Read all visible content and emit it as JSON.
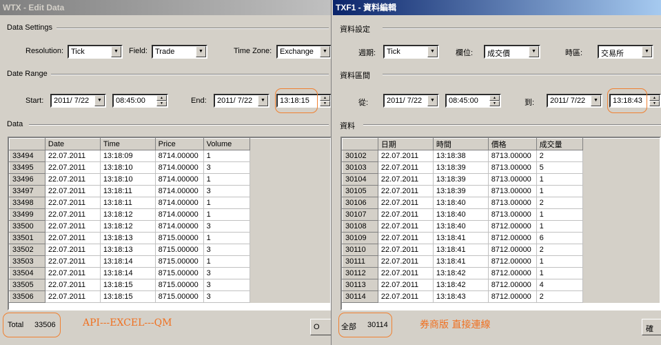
{
  "left": {
    "title": "WTX - Edit Data",
    "settings_label": "Data Settings",
    "resolution_label": "Resolution:",
    "resolution_value": "Tick",
    "field_label": "Field:",
    "field_value": "Trade",
    "timezone_label": "Time Zone:",
    "timezone_value": "Exchange",
    "range_label": "Date Range",
    "start_label": "Start:",
    "start_date": "2011/ 7/22",
    "start_time": "08:45:00",
    "end_label": "End:",
    "end_date": "2011/ 7/22",
    "end_time": "13:18:15",
    "data_label": "Data",
    "columns": [
      "Date",
      "Time",
      "Price",
      "Volume"
    ],
    "rows": [
      [
        "33494",
        "22.07.2011",
        "13:18:09",
        "8714.00000",
        "1"
      ],
      [
        "33495",
        "22.07.2011",
        "13:18:10",
        "8714.00000",
        "3"
      ],
      [
        "33496",
        "22.07.2011",
        "13:18:10",
        "8714.00000",
        "1"
      ],
      [
        "33497",
        "22.07.2011",
        "13:18:11",
        "8714.00000",
        "3"
      ],
      [
        "33498",
        "22.07.2011",
        "13:18:11",
        "8714.00000",
        "1"
      ],
      [
        "33499",
        "22.07.2011",
        "13:18:12",
        "8714.00000",
        "1"
      ],
      [
        "33500",
        "22.07.2011",
        "13:18:12",
        "8714.00000",
        "3"
      ],
      [
        "33501",
        "22.07.2011",
        "13:18:13",
        "8715.00000",
        "1"
      ],
      [
        "33502",
        "22.07.2011",
        "13:18:13",
        "8715.00000",
        "3"
      ],
      [
        "33503",
        "22.07.2011",
        "13:18:14",
        "8715.00000",
        "1"
      ],
      [
        "33504",
        "22.07.2011",
        "13:18:14",
        "8715.00000",
        "3"
      ],
      [
        "33505",
        "22.07.2011",
        "13:18:15",
        "8715.00000",
        "3"
      ],
      [
        "33506",
        "22.07.2011",
        "13:18:15",
        "8715.00000",
        "3"
      ]
    ],
    "total_label": "Total",
    "total_value": "33506",
    "annotation": "API---EXCEL---QM",
    "button_label": "O"
  },
  "right": {
    "title": "TXF1 - 資料編輯",
    "settings_label": "資料設定",
    "resolution_label": "週期:",
    "resolution_value": "Tick",
    "field_label": "欄位:",
    "field_value": "成交價",
    "timezone_label": "時區:",
    "timezone_value": "交易所",
    "range_label": "資料區間",
    "start_label": "從:",
    "start_date": "2011/ 7/22",
    "start_time": "08:45:00",
    "end_label": "到:",
    "end_date": "2011/ 7/22",
    "end_time": "13:18:43",
    "data_label": "資料",
    "columns": [
      "日期",
      "時間",
      "價格",
      "成交量"
    ],
    "rows": [
      [
        "30102",
        "22.07.2011",
        "13:18:38",
        "8713.00000",
        "2"
      ],
      [
        "30103",
        "22.07.2011",
        "13:18:39",
        "8713.00000",
        "5"
      ],
      [
        "30104",
        "22.07.2011",
        "13:18:39",
        "8713.00000",
        "1"
      ],
      [
        "30105",
        "22.07.2011",
        "13:18:39",
        "8713.00000",
        "1"
      ],
      [
        "30106",
        "22.07.2011",
        "13:18:40",
        "8713.00000",
        "2"
      ],
      [
        "30107",
        "22.07.2011",
        "13:18:40",
        "8713.00000",
        "1"
      ],
      [
        "30108",
        "22.07.2011",
        "13:18:40",
        "8712.00000",
        "1"
      ],
      [
        "30109",
        "22.07.2011",
        "13:18:41",
        "8712.00000",
        "6"
      ],
      [
        "30110",
        "22.07.2011",
        "13:18:41",
        "8712.00000",
        "2"
      ],
      [
        "30111",
        "22.07.2011",
        "13:18:41",
        "8712.00000",
        "1"
      ],
      [
        "30112",
        "22.07.2011",
        "13:18:42",
        "8712.00000",
        "1"
      ],
      [
        "30113",
        "22.07.2011",
        "13:18:42",
        "8712.00000",
        "4"
      ],
      [
        "30114",
        "22.07.2011",
        "13:18:43",
        "8712.00000",
        "2"
      ]
    ],
    "total_label": "全部",
    "total_value": "30114",
    "annotation": "券商版 直接連線",
    "button_label": "確"
  },
  "colors": {
    "highlight": "#f08030",
    "annotation": "#f07020",
    "active_title": "#0a246a",
    "inactive_title": "#808080"
  }
}
